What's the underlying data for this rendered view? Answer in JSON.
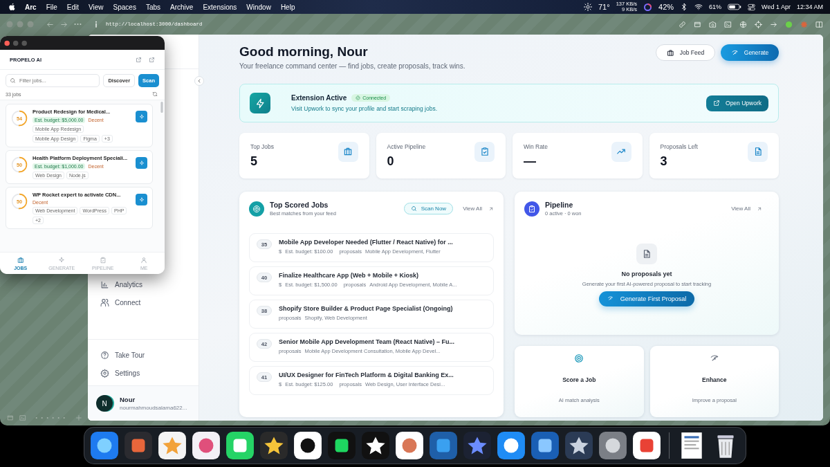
{
  "menu_bar": {
    "app": "Arc",
    "items": [
      "File",
      "Edit",
      "View",
      "Spaces",
      "Tabs",
      "Archive",
      "Extensions",
      "Window",
      "Help"
    ],
    "status": {
      "temperature": "71°",
      "upload": "137 KB/s",
      "download": "9 KB/s",
      "cpu": "42%",
      "battery": "61%",
      "date": "Wed 1 Apr",
      "time": "12:34 AM"
    }
  },
  "browser": {
    "url": "http://localhost:3000/dashboard"
  },
  "sidebar": {
    "items": [
      {
        "label": "Analytics"
      },
      {
        "label": "Connect"
      }
    ],
    "footer_items": [
      {
        "label": "Take Tour"
      },
      {
        "label": "Settings"
      }
    ],
    "user": {
      "initial": "N",
      "name": "Nour",
      "email": "nourmahmoudsalama622..."
    }
  },
  "header": {
    "title": "Good morning, Nour",
    "subtitle": "Your freelance command center — find jobs, create proposals, track wins.",
    "buttons": [
      {
        "label": "Job Feed",
        "kind": "secondary"
      },
      {
        "label": "Generate",
        "kind": "primary"
      }
    ]
  },
  "extension_banner": {
    "title": "Extension Active",
    "badge": "Connected",
    "text": "Visit Upwork to sync your profile and start scraping jobs.",
    "button": "Open Upwork"
  },
  "stats": [
    {
      "label": "Top Jobs",
      "value": "5"
    },
    {
      "label": "Active Pipeline",
      "value": "0"
    },
    {
      "label": "Win Rate",
      "value": "—"
    },
    {
      "label": "Proposals Left",
      "value": "3"
    }
  ],
  "top_jobs": {
    "title": "Top Scored Jobs",
    "subtitle": "Best matches from your feed",
    "scan_button": "Scan Now",
    "view_all": "View All",
    "jobs": [
      {
        "score": "35",
        "title": "Mobile App Developer Needed (Flutter / React Native) for ...",
        "currency": "$",
        "budget": "Est. budget: $100.00",
        "proposals": "proposals",
        "skills": "Mobile App Development, Flutter"
      },
      {
        "score": "40",
        "title": "Finalize Healthcare App (Web + Mobile + Kiosk)",
        "currency": "$",
        "budget": "Est. budget: $1,500.00",
        "proposals": "proposals",
        "skills": "Android App Development, Mobile A..."
      },
      {
        "score": "38",
        "title": "Shopify Store Builder & Product Page Specialist (Ongoing)",
        "proposals": "proposals",
        "skills": "Shopify, Web Development"
      },
      {
        "score": "42",
        "title": "Senior Mobile App Development Team (React Native) – Fu...",
        "proposals": "proposals",
        "skills": "Mobile App Development Consultation, Mobile App Devel..."
      },
      {
        "score": "41",
        "title": "UI/UX Designer for FinTech Platform & Digital Banking Ex...",
        "currency": "$",
        "budget": "Est. budget: $125.00",
        "proposals": "proposals",
        "skills": "Web Design, User Interface Desi..."
      }
    ]
  },
  "pipeline": {
    "title": "Pipeline",
    "subtitle": "0 active · 0 won",
    "view_all": "View All",
    "empty_title": "No proposals yet",
    "empty_text": "Generate your first AI-powered proposal to start tracking",
    "button": "Generate First Proposal"
  },
  "quick_actions": [
    {
      "title": "Score a Job",
      "text": "AI match analysis"
    },
    {
      "title": "Enhance",
      "text": "Improve a proposal"
    }
  ],
  "popup": {
    "logo": "PROPELO AI",
    "search": {
      "placeholder": "Filter jobs..."
    },
    "buttons": [
      {
        "label": "Discover",
        "kind": "secondary"
      },
      {
        "label": "Scan",
        "kind": "primary"
      }
    ],
    "count": "33 jobs",
    "jobs": [
      {
        "score": "54",
        "title": "Product Redesign for Medical...",
        "budget": "Est. budget: $5,000.00",
        "quality": "Decent",
        "tags": [
          "Mobile App Redesign",
          "Mobile App Design",
          "Figma",
          "+3"
        ]
      },
      {
        "score": "50",
        "title": "Health Platform Deployment Speciali...",
        "budget": "Est. budget: $1,000.00",
        "quality": "Decent",
        "tags": [
          "Web Design",
          "Node.js"
        ]
      },
      {
        "score": "50",
        "title": "WP Rocket expert to activate CDN...",
        "quality": "Decent",
        "tags": [
          "Web Development",
          "WordPress",
          "PHP",
          "+2"
        ]
      }
    ],
    "tabs": [
      {
        "label": "JOBS",
        "selected": true
      },
      {
        "label": "GENERATE",
        "selected": false
      },
      {
        "label": "PIPELINE",
        "selected": false
      },
      {
        "label": "ME",
        "selected": false
      }
    ]
  }
}
